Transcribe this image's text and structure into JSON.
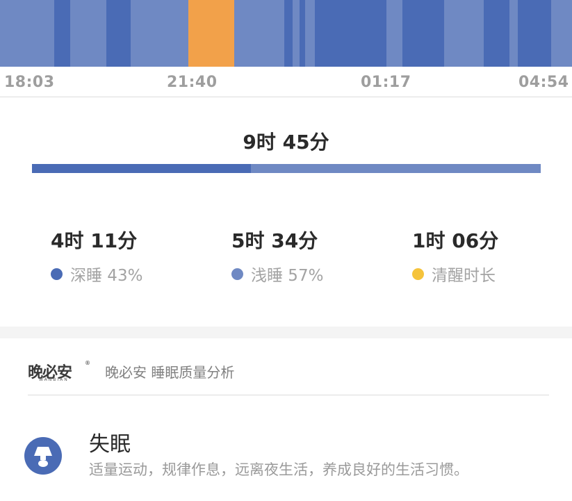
{
  "colors": {
    "deep": "#4a6bb5",
    "light": "#6f89c3",
    "awake": "#f2a14a",
    "awake_dot": "#f5c33b",
    "icon_bg": "#4a6bb5"
  },
  "sleep_chart": {
    "stages": [
      "light",
      "deep",
      "light",
      "deep",
      "light",
      "awake",
      "light",
      "deep",
      "light",
      "deep",
      "light",
      "deep",
      "light",
      "deep",
      "light",
      "deep",
      "light",
      "deep",
      "light"
    ]
  },
  "time_axis": {
    "ticks": [
      "18:03",
      "21:40",
      "01:17",
      "04:54"
    ]
  },
  "summary": {
    "total": "9时 45分",
    "deep_ratio": 0.43
  },
  "stats": [
    {
      "value": "4时 11分",
      "label": "深睡 43%",
      "color": "#4a6bb5"
    },
    {
      "value": "5时 34分",
      "label": "浅睡 57%",
      "color": "#6f89c3"
    },
    {
      "value": "1时 06分",
      "label": "清醒时长",
      "color": "#f5c33b"
    }
  ],
  "brand": {
    "logo_cn": "晚必安",
    "logo_en": "WANBIAN",
    "logo_mark": "®",
    "text": "晚必安 睡眠质量分析"
  },
  "result": {
    "icon": "lamp-icon",
    "title": "失眠",
    "desc": "适量运动，规律作息，远离夜生活，养成良好的生活习惯。"
  }
}
